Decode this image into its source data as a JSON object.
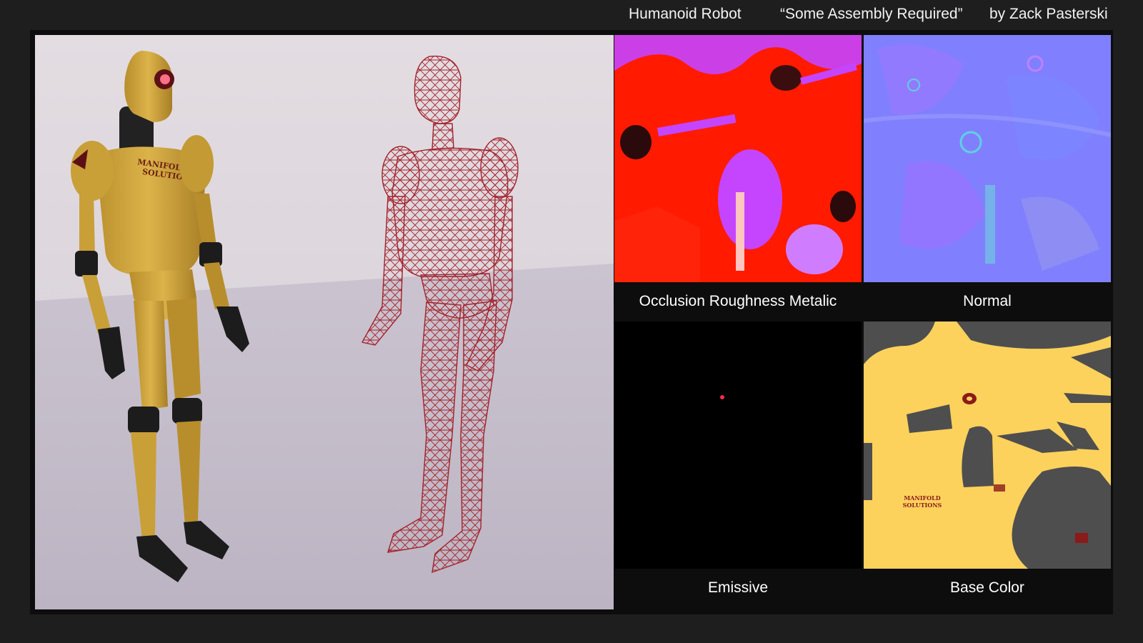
{
  "header": {
    "subject": "Humanoid Robot",
    "project": "“Some Assembly Required”",
    "author": "by Zack Pasterski"
  },
  "viewport": {
    "chest_logo_line1": "MANIFOLD",
    "chest_logo_line2": "SOLUTIONS",
    "robot_body_color": "#d4a93c",
    "joint_color": "#1c1c1c",
    "wireframe_color": "#a3222b",
    "background_color": "#dcd6de"
  },
  "textures": [
    {
      "caption": "Occlusion Roughness Metalic",
      "colors": [
        "#ff1a00",
        "#c545ff",
        "#7a4dff"
      ]
    },
    {
      "caption": "Normal",
      "colors": [
        "#8080ff",
        "#a070ff",
        "#60d0e0"
      ]
    },
    {
      "caption": "Emissive",
      "colors": [
        "#000000",
        "#ff2a4a"
      ]
    },
    {
      "caption": "Base Color",
      "colors": [
        "#fcd25c",
        "#4e4e4e",
        "#8b1a1a"
      ],
      "logo_line1": "MANIFOLD",
      "logo_line2": "SOLUTIONS"
    }
  ]
}
